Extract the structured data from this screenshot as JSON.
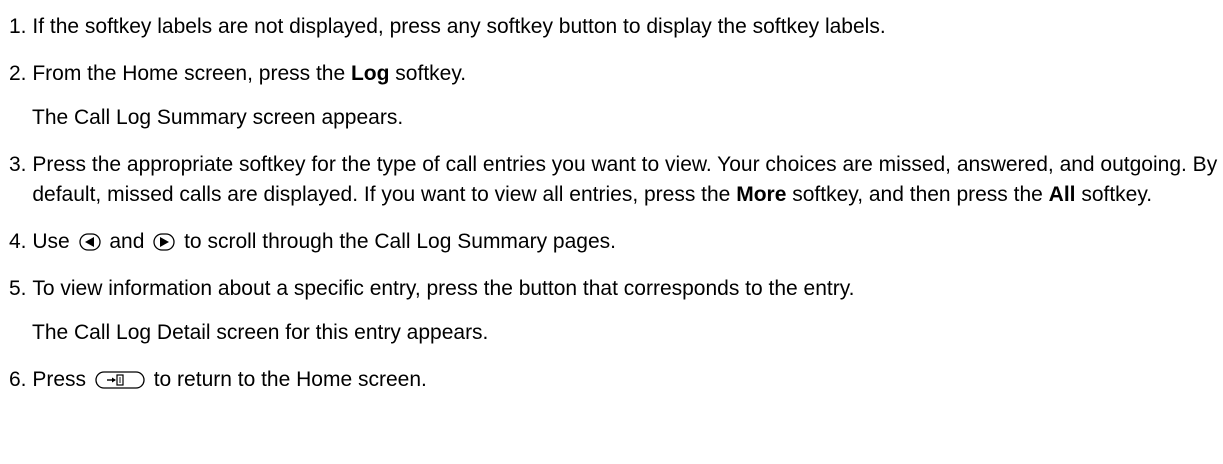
{
  "steps": [
    {
      "num": "1. ",
      "text": "If the softkey labels are not displayed, press any softkey button to display the softkey labels."
    },
    {
      "num": "2. ",
      "pre": "From the Home screen, press the ",
      "bold": "Log",
      "post": " softkey.",
      "after": "The Call Log Summary screen appears."
    },
    {
      "num": "3. ",
      "pre": "Press the appropriate softkey for the type of call entries you want to view. Your choices are missed, answered, and outgoing. By default, missed calls are displayed. If you want to view all entries, press the ",
      "bold1": "More",
      "mid": " softkey, and then press the ",
      "bold2": "All",
      "post": " softkey."
    },
    {
      "num": "4. ",
      "pre": "Use ",
      "icon1": "left-arrow-button-icon",
      "mid": " and ",
      "icon2": "right-arrow-button-icon",
      "post": " to scroll through the Call Log Summary pages."
    },
    {
      "num": "5. ",
      "text": "To view information about a specific entry, press the button that corresponds to the entry.",
      "after": "The Call Log Detail screen for this entry appears."
    },
    {
      "num": "6. ",
      "pre": "Press ",
      "icon": "exit-button-icon",
      "post": " to return to the Home screen."
    }
  ]
}
